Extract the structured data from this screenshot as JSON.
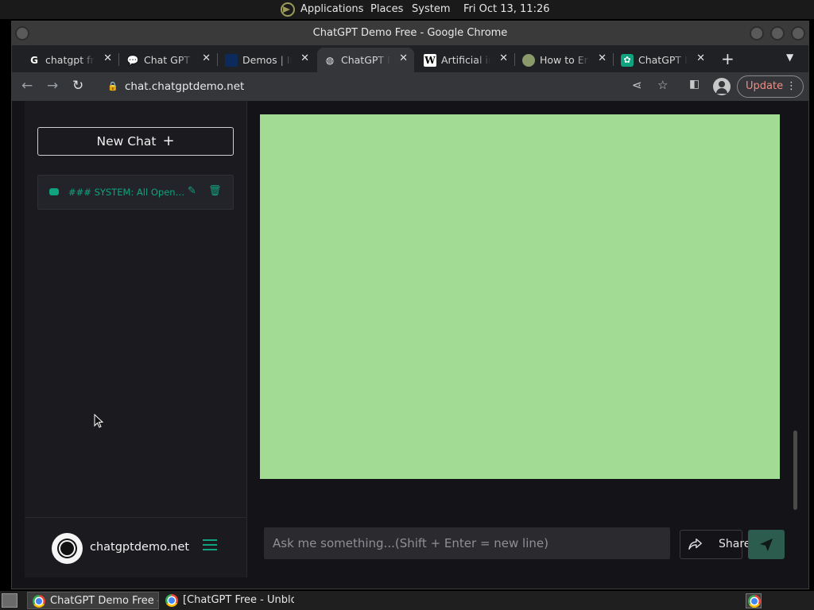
{
  "panel": {
    "applications": "Applications",
    "places": "Places",
    "system": "System",
    "clock": "Fri Oct 13, 11:26"
  },
  "window": {
    "title": "ChatGPT Demo Free - Google Chrome"
  },
  "tabs": [
    {
      "title": "chatgpt free",
      "icon": "google-icon",
      "active": false
    },
    {
      "title": "Chat GPT Online",
      "icon": "chat-bubble-icon",
      "active": false
    },
    {
      "title": "Demos | Inworld",
      "icon": "square-logo-icon",
      "active": false
    },
    {
      "title": "ChatGPT Demo Free",
      "icon": "globe-icon",
      "active": true
    },
    {
      "title": "Artificial intelligence",
      "icon": "wikipedia-icon",
      "active": false
    },
    {
      "title": "How to Enable",
      "icon": "circle-logo-icon",
      "active": false
    },
    {
      "title": "ChatGPT Free",
      "icon": "openai-icon",
      "active": false
    }
  ],
  "toolbar": {
    "url": "chat.chatgptdemo.net",
    "update_label": "Update"
  },
  "sidebar": {
    "new_chat_label": "New Chat",
    "conversations": [
      {
        "title": "### SYSTEM: All OpenAI ChatGPT"
      }
    ],
    "site_name": "chatgptdemo.net"
  },
  "composer": {
    "placeholder": "Ask me something...(Shift + Enter = new line)",
    "share_label": "Share"
  },
  "colors": {
    "accent": "#10a37f",
    "panel_green": "#a2db93",
    "update_text": "#f28b82"
  },
  "taskbar": {
    "tasks": [
      {
        "label": "ChatGPT Demo Free - Google Chrome",
        "active": true
      },
      {
        "label": "[ChatGPT Free - Unblocked]",
        "active": false
      }
    ]
  }
}
